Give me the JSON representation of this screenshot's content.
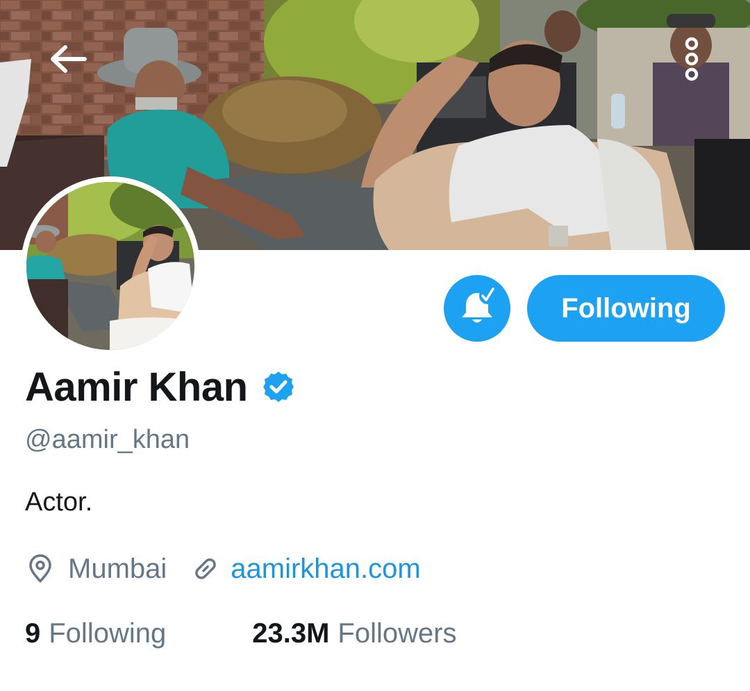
{
  "header": {
    "back_icon": "arrow-left-icon",
    "more_icon": "vertical-dots-icon"
  },
  "profile": {
    "name": "Aamir Khan",
    "verified_icon": "verified-badge-icon",
    "handle": "@aamir_khan",
    "bio": "Actor.",
    "location": "Mumbai",
    "location_icon": "location-pin-icon",
    "link_icon": "link-icon",
    "website": "aamirkhan.com"
  },
  "actions": {
    "notifications_icon": "bell-check-icon",
    "follow_label": "Following"
  },
  "stats": {
    "following_count": "9",
    "following_label": "Following",
    "followers_count": "23.3M",
    "followers_label": "Followers"
  },
  "colors": {
    "accent": "#1da1f2",
    "link": "#1b95e0",
    "text_primary": "#14171a",
    "text_secondary": "#657786"
  }
}
